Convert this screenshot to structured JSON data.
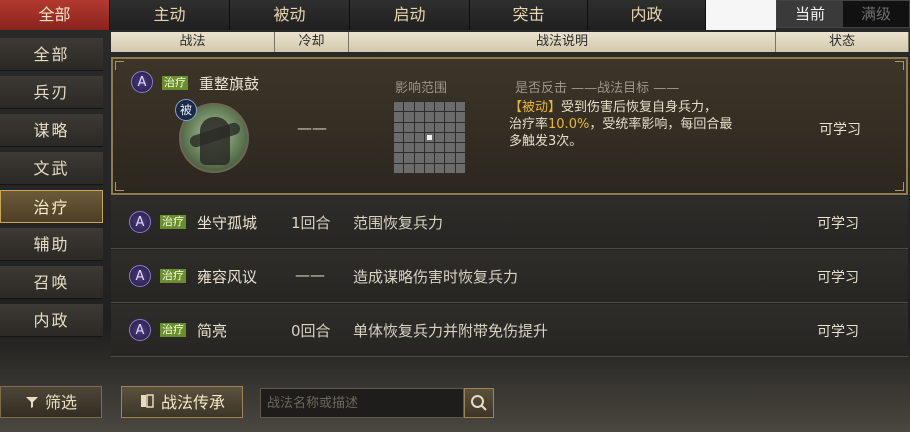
{
  "top_tabs": [
    {
      "label": "全部"
    },
    {
      "label": "主动"
    },
    {
      "label": "被动"
    },
    {
      "label": "启动"
    },
    {
      "label": "突击"
    },
    {
      "label": "内政"
    }
  ],
  "level_toggle": {
    "current": "当前",
    "max": "满级"
  },
  "sidebar": [
    {
      "label": "全部"
    },
    {
      "label": "兵刃"
    },
    {
      "label": "谋略"
    },
    {
      "label": "文武"
    },
    {
      "label": "治疗"
    },
    {
      "label": "辅助"
    },
    {
      "label": "召唤"
    },
    {
      "label": "内政"
    }
  ],
  "columns": {
    "skill": "战法",
    "cooldown": "冷却",
    "description": "战法说明",
    "status": "状态"
  },
  "expanded": {
    "grade": "A",
    "category": "治疗",
    "name": "重整旗鼓",
    "portrait_badge": "被",
    "cooldown": "——",
    "range_label": "影响范围",
    "counter_line": "是否反击 ——战法目标 ——",
    "effect_prefix": "【被动】",
    "effect_1": "受到伤害后恢复自身兵力，",
    "effect_2a": "治疗率",
    "effect_rate": "10.0%",
    "effect_2b": "，受统率影响，每回合最",
    "effect_3": "多触发3次。",
    "status": "可学习"
  },
  "rows": [
    {
      "grade": "A",
      "category": "治疗",
      "name": "坐守孤城",
      "cooldown": "1回合",
      "description": "范围恢复兵力",
      "status": "可学习"
    },
    {
      "grade": "A",
      "category": "治疗",
      "name": "雍容风议",
      "cooldown": "——",
      "description": "造成谋略伤害时恢复兵力",
      "status": "可学习"
    },
    {
      "grade": "A",
      "category": "治疗",
      "name": "简亮",
      "cooldown": "0回合",
      "description": "单体恢复兵力并附带免伤提升",
      "status": "可学习"
    }
  ],
  "bottom": {
    "filter_label": "筛选",
    "inherit_label": "战法传承",
    "search_placeholder": "战法名称或描述"
  },
  "colors": {
    "active_tab": "#b23a30",
    "heal_tag": "#6a8d2e",
    "gold_text": "#e7b83d"
  }
}
